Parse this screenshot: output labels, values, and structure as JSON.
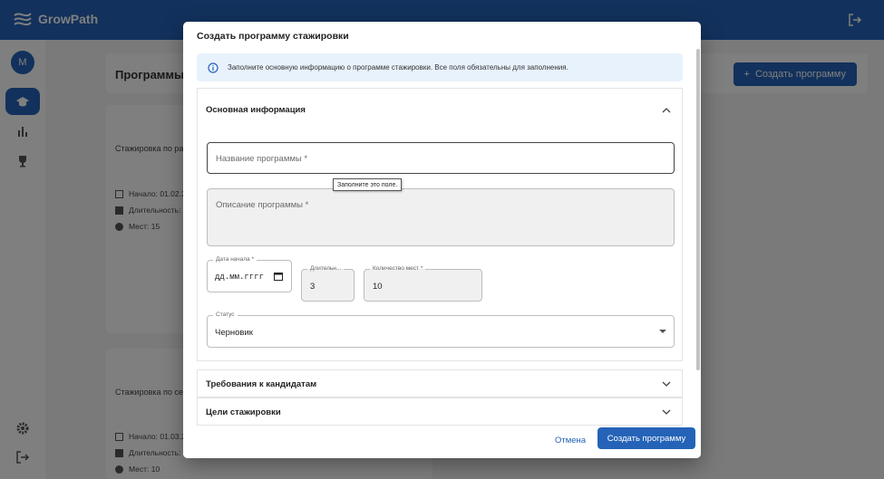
{
  "app": {
    "brand": "GrowPath",
    "avatar_letter": "M"
  },
  "page": {
    "title": "Программы ст",
    "create_button": "Создать программу"
  },
  "cards": [
    {
      "title": "Стажировка по раз",
      "start": "Начало: 01.02.2",
      "duration": "Длительность:",
      "seats": "Мест: 15"
    },
    {
      "title": "Стажировка по сер",
      "start": "Начало: 01.03.2",
      "duration": "Длительность:",
      "seats": "Мест: 10"
    }
  ],
  "modal": {
    "title": "Создать программу стажировки",
    "info_text": "Заполните основную информацию о программе стажировки. Все поля обязательны для заполнения.",
    "sections": {
      "basic": "Основная информация",
      "requirements": "Требования к кандидатам",
      "goals": "Цели стажировки"
    },
    "fields": {
      "name_placeholder": "Название программы *",
      "tooltip": "Заполните это поле.",
      "description_placeholder": "Описание программы *",
      "start_date_label": "Дата начала *",
      "start_date_value": "дд.мм.гггг",
      "duration_label": "Длительн...",
      "duration_value": "3",
      "seats_label": "Количество мест *",
      "seats_value": "10",
      "status_label": "Статус",
      "status_value": "Черновик"
    },
    "footer": {
      "cancel": "Отмена",
      "submit": "Создать программу"
    }
  },
  "colors": {
    "primary": "#2563b8",
    "info_bg": "#e8f2fc"
  }
}
